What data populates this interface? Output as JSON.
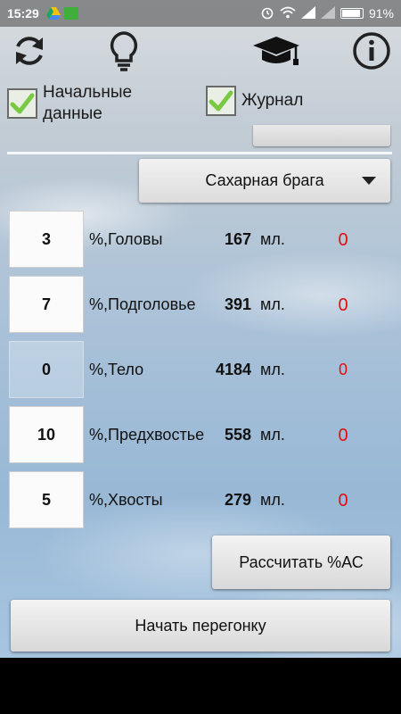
{
  "status_bar": {
    "time": "15:29",
    "battery": "91%",
    "battery_level": 0.91
  },
  "toolbar": {
    "icons": [
      "refresh-icon",
      "lightbulb-icon",
      "graduation-cap-icon",
      "info-icon"
    ]
  },
  "checks": {
    "initial_data": {
      "label_line1": "Начальные",
      "label_line2": "данные",
      "checked": true
    },
    "journal": {
      "label": "Журнал",
      "checked": true
    }
  },
  "dropdown": {
    "selected": "Сахарная брага"
  },
  "fractions": [
    {
      "percent": "3",
      "label": "%,Головы",
      "ml": "167",
      "unit": "мл.",
      "result": "0"
    },
    {
      "percent": "7",
      "label": "%,Подголовье",
      "ml": "391",
      "unit": "мл.",
      "result": "0"
    },
    {
      "percent": "0",
      "label": "%,Тело",
      "ml": "4184",
      "unit": "мл.",
      "result": "0"
    },
    {
      "percent": "10",
      "label": "%,Предхвостье",
      "ml": "558",
      "unit": "мл.",
      "result": "0"
    },
    {
      "percent": "5",
      "label": "%,Хвосты",
      "ml": "279",
      "unit": "мл.",
      "result": "0"
    }
  ],
  "buttons": {
    "calculate": "Рассчитать %АС",
    "start": "Начать перегонку"
  },
  "colors": {
    "result_red": "#e01010",
    "check_green": "#7ac943"
  }
}
